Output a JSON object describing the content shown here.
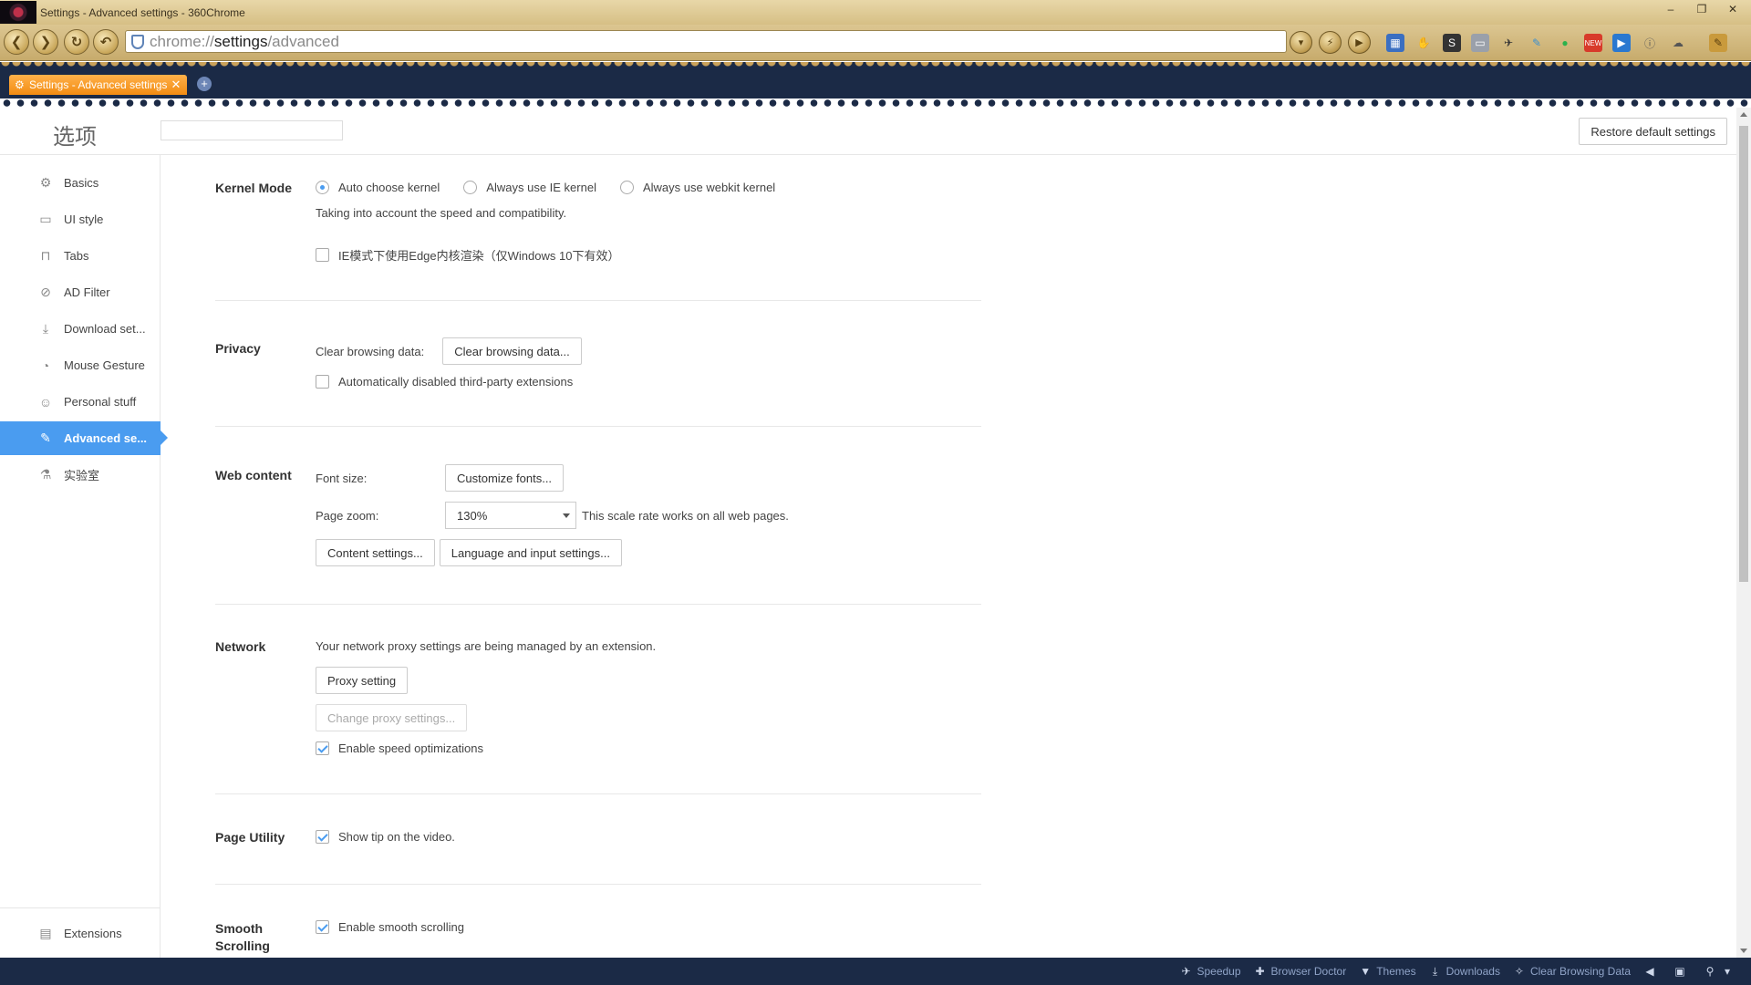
{
  "window": {
    "title": "Settings - Advanced settings - 360Chrome",
    "minimize": "–",
    "restore": "❐",
    "close": "✕"
  },
  "toolbar": {
    "url_scheme": "chrome://",
    "url_host": "settings",
    "url_path": "/advanced",
    "back": "❮",
    "forward": "❯",
    "reload": "↻",
    "undo": "↶"
  },
  "tab": {
    "title": "Settings - Advanced settings",
    "close": "✕",
    "new_tab": "+"
  },
  "header": {
    "page_title": "选项",
    "search_placeholder": "",
    "restore_label": "Restore default settings"
  },
  "sidebar": {
    "items": [
      {
        "label": "Basics",
        "icon": "gear-icon"
      },
      {
        "label": "UI style",
        "icon": "window-icon"
      },
      {
        "label": "Tabs",
        "icon": "tab-icon"
      },
      {
        "label": "AD Filter",
        "icon": "block-icon"
      },
      {
        "label": "Download set...",
        "icon": "download-icon"
      },
      {
        "label": "Mouse Gesture",
        "icon": "mouse-icon"
      },
      {
        "label": "Personal stuff",
        "icon": "person-icon"
      },
      {
        "label": "Advanced se...",
        "icon": "wrench-icon"
      },
      {
        "label": "实验室",
        "icon": "flask-icon"
      }
    ],
    "bottom_label": "Extensions"
  },
  "kernel": {
    "label": "Kernel Mode",
    "options": [
      "Auto choose kernel",
      "Always use IE kernel",
      "Always use webkit kernel"
    ],
    "hint": "Taking into account the speed and compatibility.",
    "edge_checkbox": "IE模式下使用Edge内核渲染（仅Windows 10下有效）"
  },
  "privacy": {
    "label": "Privacy",
    "clear_label": "Clear browsing data:",
    "clear_button": "Clear browsing data...",
    "extensions_checkbox": "Automatically disabled third-party extensions"
  },
  "web_content": {
    "label": "Web content",
    "font_size_label": "Font size:",
    "customize_fonts": "Customize fonts...",
    "page_zoom_label": "Page zoom:",
    "zoom_value": "130%",
    "zoom_hint": "This scale rate works on all web pages.",
    "content_settings": "Content settings...",
    "language_settings": "Language and input settings..."
  },
  "network": {
    "label": "Network",
    "notice": "Your network proxy settings are being managed by an extension.",
    "proxy_setting": "Proxy setting",
    "change_proxy": "Change proxy settings...",
    "speed_checkbox": "Enable speed optimizations"
  },
  "page_utility": {
    "label": "Page Utility",
    "video_tip": "Show tip on the video."
  },
  "smooth_scrolling": {
    "label_line1": "Smooth",
    "label_line2": "Scrolling",
    "checkbox": "Enable smooth scrolling"
  },
  "statusbar": {
    "items": [
      "Speedup",
      "Browser Doctor",
      "Themes",
      "Downloads",
      "Clear Browsing Data"
    ]
  }
}
